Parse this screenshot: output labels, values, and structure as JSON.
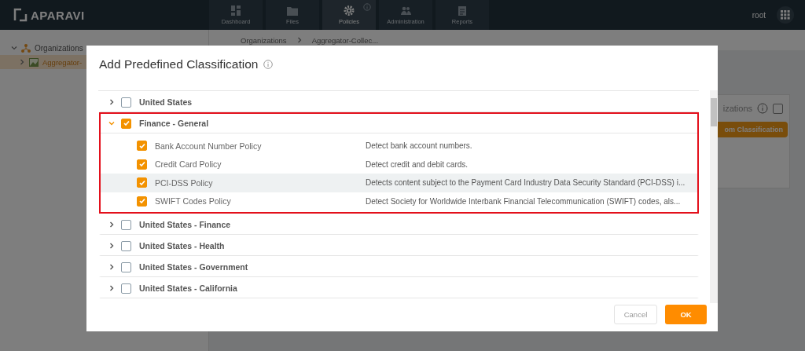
{
  "app": {
    "logo": "APARAVI",
    "user": "root"
  },
  "nav_tabs": [
    {
      "label": "Dashboard",
      "selected": false,
      "badge": false
    },
    {
      "label": "Files",
      "selected": false,
      "badge": false
    },
    {
      "label": "Policies",
      "selected": true,
      "badge": true
    },
    {
      "label": "Administration",
      "selected": false,
      "badge": false
    },
    {
      "label": "Reports",
      "selected": false,
      "badge": false
    }
  ],
  "sidebar": {
    "items": [
      {
        "label": "Organizations",
        "selected": false,
        "children": [
          {
            "label": "Aggregator-",
            "selected": true
          }
        ]
      }
    ]
  },
  "breadcrumb": [
    "Organizations",
    "Aggregator-Collec..."
  ],
  "background_panel": {
    "title": "izations",
    "checked": false,
    "button": "om Classification"
  },
  "dialog": {
    "title": "Add Predefined Classification",
    "groups": [
      {
        "label": "United States",
        "checked": false,
        "expanded": false,
        "outlined": false
      },
      {
        "label": "Finance - General",
        "checked": true,
        "expanded": true,
        "outlined": true,
        "children": [
          {
            "name": "Bank Account Number Policy",
            "description": "Detect bank account numbers.",
            "checked": true,
            "highlighted": false
          },
          {
            "name": "Credit Card Policy",
            "description": "Detect credit and debit cards.",
            "checked": true,
            "highlighted": false
          },
          {
            "name": "PCI-DSS Policy",
            "description": "Detects content subject to the Payment Card Industry Data Security Standard (PCI-DSS) i...",
            "checked": true,
            "highlighted": true
          },
          {
            "name": "SWIFT Codes Policy",
            "description": "Detect Society for Worldwide Interbank Financial Telecommunication (SWIFT) codes, als...",
            "checked": true,
            "highlighted": false
          }
        ]
      },
      {
        "label": "United States - Finance",
        "checked": false,
        "expanded": false,
        "outlined": false
      },
      {
        "label": "United States - Health",
        "checked": false,
        "expanded": false,
        "outlined": false
      },
      {
        "label": "United States - Government",
        "checked": false,
        "expanded": false,
        "outlined": false
      },
      {
        "label": "United States - California",
        "checked": false,
        "expanded": false,
        "outlined": false
      }
    ],
    "buttons": [
      {
        "label": "Cancel",
        "kind": "secondary"
      },
      {
        "label": "OK",
        "kind": "primary"
      }
    ]
  }
}
